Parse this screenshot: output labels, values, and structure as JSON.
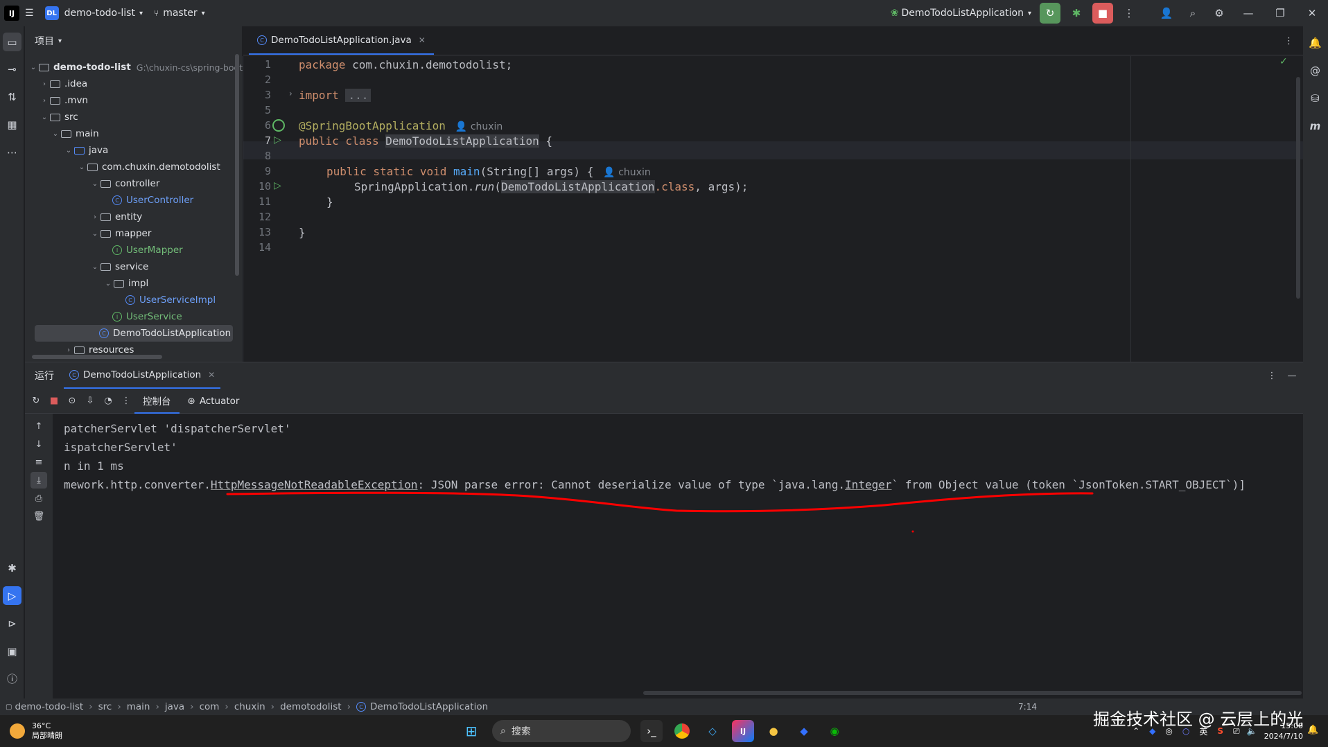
{
  "titlebar": {
    "logo": "IJ",
    "project_badge": "DL",
    "project_name": "demo-todo-list",
    "branch": "master",
    "run_config": "DemoTodoListApplication"
  },
  "project_panel": {
    "title": "项目",
    "root": {
      "name": "demo-todo-list",
      "path": "G:\\chuxin-cs\\spring-boot"
    },
    "items": [
      {
        "label": ".idea"
      },
      {
        "label": ".mvn"
      },
      {
        "label": "src"
      },
      {
        "label": "main"
      },
      {
        "label": "java"
      },
      {
        "label": "com.chuxin.demotodolist"
      },
      {
        "label": "controller"
      },
      {
        "label": "UserController"
      },
      {
        "label": "entity"
      },
      {
        "label": "mapper"
      },
      {
        "label": "UserMapper"
      },
      {
        "label": "service"
      },
      {
        "label": "impl"
      },
      {
        "label": "UserServiceImpl"
      },
      {
        "label": "UserService"
      },
      {
        "label": "DemoTodoListApplication"
      },
      {
        "label": "resources"
      }
    ]
  },
  "editor": {
    "tab": "DemoTodoListApplication.java",
    "line_numbers": [
      "1",
      "2",
      "3",
      "5",
      "6",
      "7",
      "8",
      "9",
      "10",
      "11",
      "12",
      "13",
      "14"
    ],
    "code": {
      "package_kw": "package",
      "package_name": " com.chuxin.demotodolist;",
      "import_kw": "import",
      "import_fold": "...",
      "annotation": "@SpringBootApplication",
      "author": "chuxin",
      "class_kw": "public class",
      "class_name": "DemoTodoListApplication",
      "class_open": " {",
      "main_kw": "public static void",
      "main_fn": "main",
      "main_args": "(String[] args) {",
      "main_author": "chuxin",
      "spring_app": "SpringApplication.",
      "run_fn": "run",
      "run_open": "(",
      "run_class": "DemoTodoListApplication",
      "class_kw2": ".class",
      "run_args": ", args);",
      "close_inner": "}",
      "close_outer": "}"
    }
  },
  "run_panel": {
    "title": "运行",
    "tab": "DemoTodoListApplication",
    "console_tab": "控制台",
    "actuator_tab": "Actuator",
    "lines": [
      "patcherServlet 'dispatcherServlet'",
      "ispatcherServlet'",
      "n in 1 ms"
    ],
    "error": {
      "prefix": "mework.http.converter.",
      "exception": "HttpMessageNotReadableException",
      "mid": ": JSON parse error: Cannot deserialize value of type `java.lang.",
      "type": "Integer",
      "suffix": "` from Object value (token `JsonToken.START_OBJECT`)]"
    }
  },
  "statusbar": {
    "breadcrumbs": [
      "demo-todo-list",
      "src",
      "main",
      "java",
      "com",
      "chuxin",
      "demotodolist",
      "DemoTodoListApplication"
    ],
    "position": "7:14"
  },
  "taskbar": {
    "temperature": "36°C",
    "weather": "局部晴朗",
    "search_placeholder": "搜索",
    "ime": "英",
    "time": "15:00",
    "date": "2024/7/10",
    "watermark": "掘金技术社区 @ 云层上的光"
  },
  "colors": {
    "accent": "#3574f0",
    "error_underline": "#ff0000",
    "run_green": "#57965c",
    "stop_red": "#db5c5c"
  }
}
